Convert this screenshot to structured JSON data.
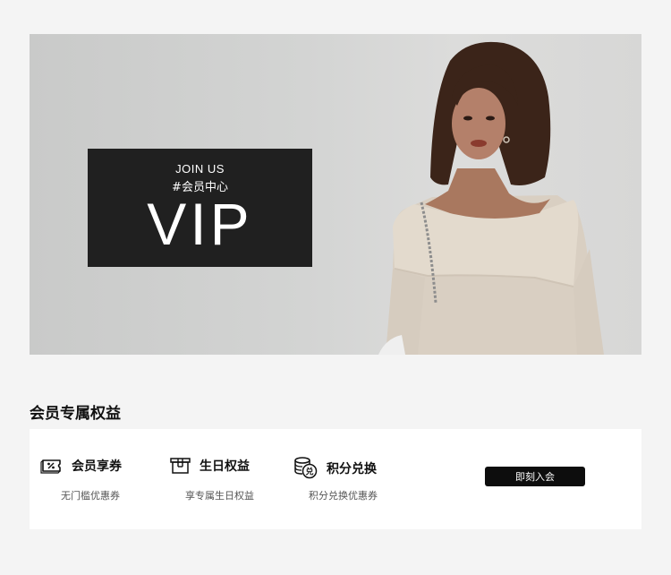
{
  "banner": {
    "join_text": "JOIN US",
    "tag_text": "#会员中心",
    "vip_text": "VIP"
  },
  "section": {
    "title": "会员专属权益"
  },
  "benefits": [
    {
      "icon": "coupon-icon",
      "name": "会员享券",
      "desc": "无门槛优惠券"
    },
    {
      "icon": "gift-box-icon",
      "name": "生日权益",
      "desc": "享专属生日权益"
    },
    {
      "icon": "points-exchange-icon",
      "name": "积分兑换",
      "desc": "积分兑换优惠券"
    }
  ],
  "join_button": {
    "label": "即刻入会"
  },
  "colors": {
    "page_bg": "#f4f4f4",
    "card_bg": "#ffffff",
    "vip_box_bg": "#202020",
    "button_bg": "#0d0d0d"
  }
}
